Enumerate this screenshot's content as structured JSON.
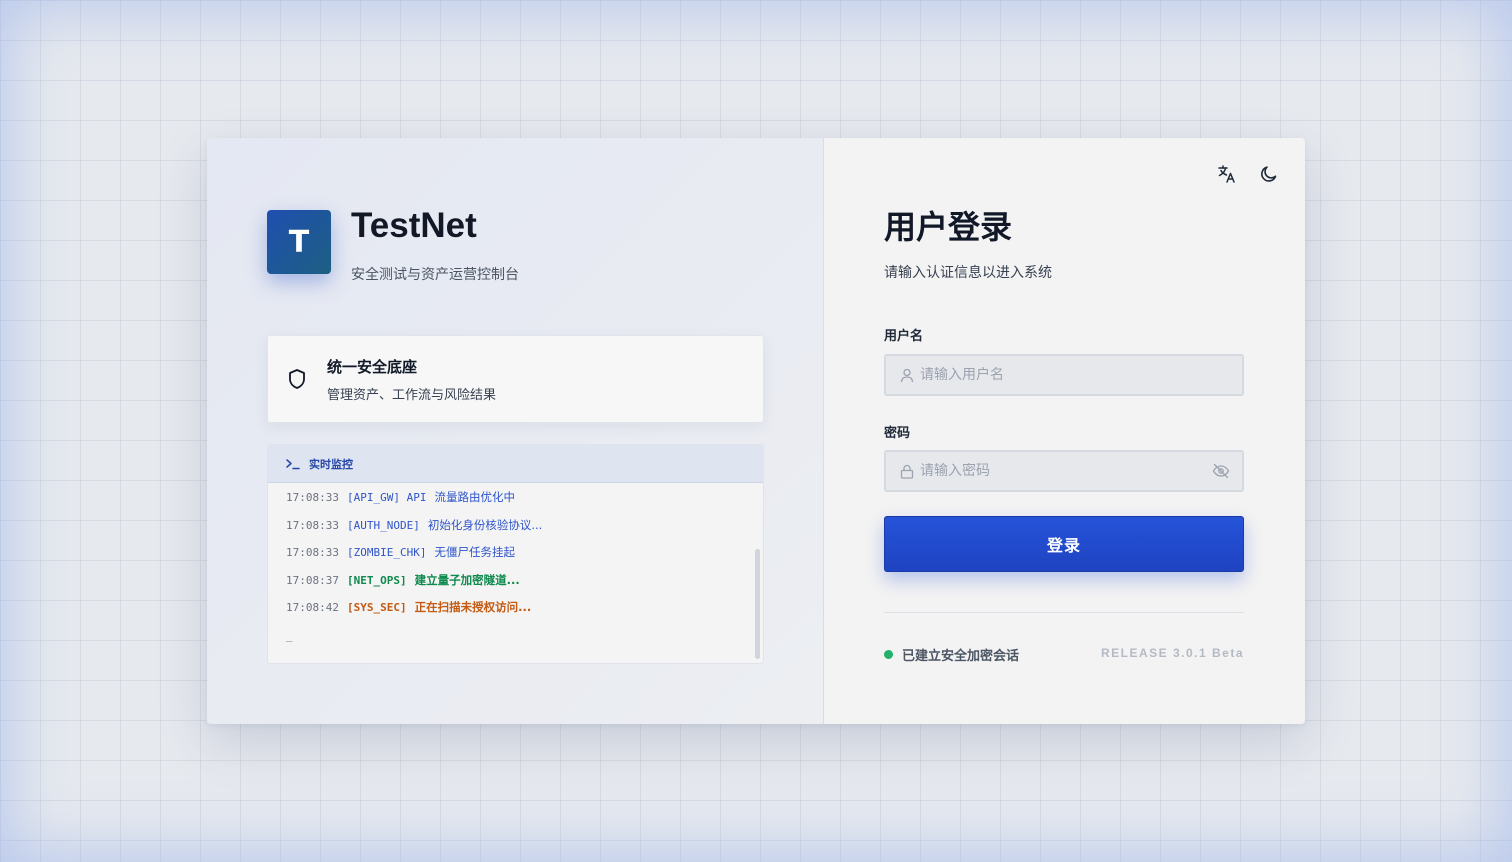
{
  "brand": {
    "logo_letter": "T",
    "name": "TestNet",
    "subtitle": "安全测试与资产运营控制台"
  },
  "feature": {
    "icon": "shield-icon",
    "title": "统一安全底座",
    "description": "管理资产、工作流与风险结果"
  },
  "terminal": {
    "icon": "terminal-icon",
    "title": "实时监控",
    "logs": [
      {
        "time": "17:08:33",
        "tag": "[API_GW] API",
        "message": "流量路由优化中",
        "color": "#2f55c8"
      },
      {
        "time": "17:08:33",
        "tag": "[AUTH_NODE]",
        "message": "初始化身份核验协议...",
        "color": "#2f55c8"
      },
      {
        "time": "17:08:33",
        "tag": "[ZOMBIE_CHK]",
        "message": "无僵尸任务挂起",
        "color": "#2f55c8"
      },
      {
        "time": "17:08:37",
        "tag": "[NET_OPS]",
        "message": "建立量子加密隧道...",
        "color": "#0f8a4e"
      },
      {
        "time": "17:08:42",
        "tag": "[SYS_SEC]",
        "message": "正在扫描未授权访问...",
        "color": "#c35a13"
      }
    ],
    "cursor": "_"
  },
  "login": {
    "title": "用户登录",
    "subtitle": "请输入认证信息以进入系统",
    "username": {
      "label": "用户名",
      "value": "",
      "placeholder": "请输入用户名"
    },
    "password": {
      "label": "密码",
      "value": "",
      "placeholder": "请输入密码"
    },
    "submit_label": "登录",
    "status_text": "已建立安全加密会话",
    "status_color": "#22b26b",
    "release": "RELEASE 3.0.1 Beta"
  },
  "toolbar": {
    "language_icon": "translate-icon",
    "theme_icon": "moon-icon"
  },
  "colors": {
    "accent": "#2553d8",
    "logo_gradient_start": "#1f4fb0",
    "logo_gradient_end": "#1d5f82"
  }
}
